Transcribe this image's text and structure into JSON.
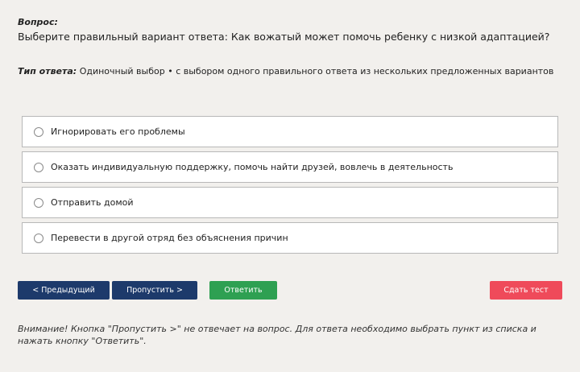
{
  "question": {
    "label": "Вопрос:",
    "text": "Выберите правильный вариант ответа: Как вожатый может помочь ребенку с низкой адаптацией?"
  },
  "answer_type": {
    "label": "Тип ответа:",
    "value": " Одиночный выбор • с выбором одного правильного ответа из нескольких предложенных вариантов"
  },
  "options": [
    {
      "text": "Игнорировать его проблемы",
      "selected": false
    },
    {
      "text": "Оказать индивидуальную поддержку, помочь найти друзей, вовлечь в деятельность",
      "selected": false
    },
    {
      "text": "Отправить домой",
      "selected": false
    },
    {
      "text": "Перевести в другой отряд без объяснения причин",
      "selected": false
    }
  ],
  "buttons": {
    "prev": "< Предыдущий",
    "skip": "Пропустить >",
    "answer": "Ответить",
    "submit": "Сдать тест"
  },
  "colors": {
    "nav_button": "#1d3a6b",
    "answer_button": "#2ea052",
    "submit_button": "#ef4a5a",
    "background": "#f2f0ed"
  },
  "notice": "Внимание! Кнопка \"Пропустить >\" не отвечает на вопрос. Для ответа необходимо выбрать пункт из списка и нажать кнопку \"Ответить\"."
}
